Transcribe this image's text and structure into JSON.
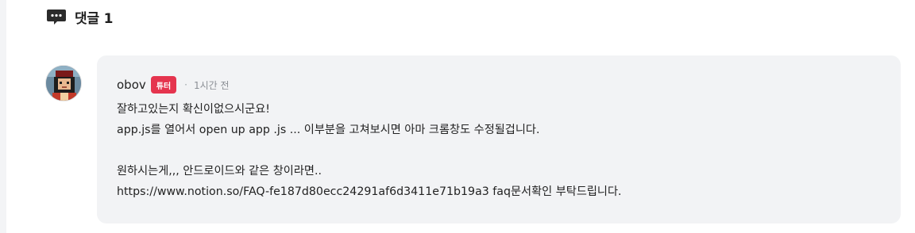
{
  "header": {
    "title": "댓글 1",
    "icon": "comment-icon"
  },
  "comment": {
    "author": "obov",
    "badge": "튜터",
    "separator": "·",
    "time": "1시간 전",
    "lines": [
      "잘하고있는지 확신이없으시군요!",
      "app.js를 열어서 open up app .js ... 이부분을 고쳐보시면 아마 크롬창도 수정될겁니다.",
      "",
      "원하시는게,,, 안드로이드와 같은 창이라면..",
      "https://www.notion.so/FAQ-fe187d80ecc24291af6d3411e71b19a3 faq문서확인 부탁드립니다."
    ]
  },
  "colors": {
    "badge_bg": "#e5344e",
    "bubble_bg": "#f2f3f5",
    "icon": "#2b2b2b"
  }
}
